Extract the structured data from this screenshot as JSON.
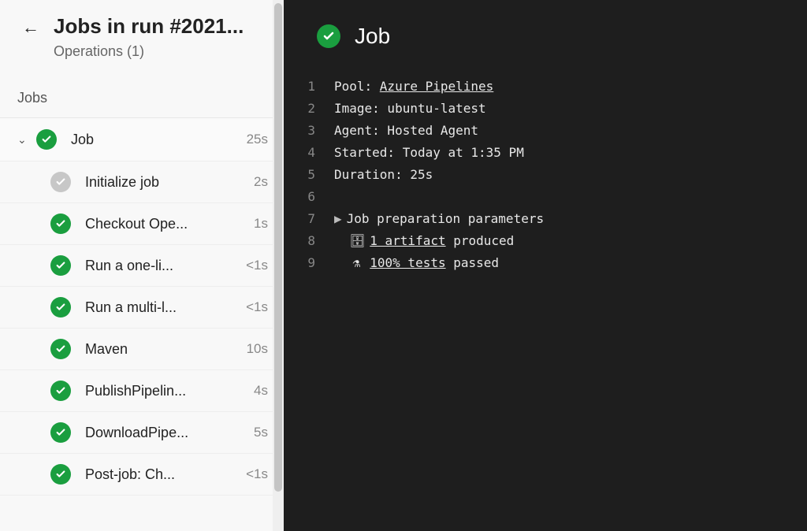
{
  "header": {
    "title": "Jobs in run #2021...",
    "subtitle": "Operations (1)"
  },
  "jobs_section_label": "Jobs",
  "job": {
    "name": "Job",
    "duration": "25s",
    "status": "success"
  },
  "steps": [
    {
      "name": "Initialize job",
      "duration": "2s",
      "status": "grey"
    },
    {
      "name": "Checkout Ope...",
      "duration": "1s",
      "status": "success"
    },
    {
      "name": "Run a one-li...",
      "duration": "<1s",
      "status": "success"
    },
    {
      "name": "Run a multi-l...",
      "duration": "<1s",
      "status": "success"
    },
    {
      "name": "Maven",
      "duration": "10s",
      "status": "success"
    },
    {
      "name": "PublishPipelin...",
      "duration": "4s",
      "status": "success"
    },
    {
      "name": "DownloadPipe...",
      "duration": "5s",
      "status": "success"
    },
    {
      "name": "Post-job: Ch...",
      "duration": "<1s",
      "status": "success"
    }
  ],
  "log": {
    "title": "Job",
    "lines": {
      "l1_label": "Pool: ",
      "l1_link": "Azure Pipelines",
      "l2": "Image: ubuntu-latest",
      "l3": "Agent: Hosted Agent",
      "l4": "Started: Today at 1:35 PM",
      "l5": "Duration: 25s",
      "l7": "Job preparation parameters",
      "l8_link": "1 artifact",
      "l8_suffix": " produced",
      "l9_link": "100% tests",
      "l9_suffix": " passed"
    }
  }
}
